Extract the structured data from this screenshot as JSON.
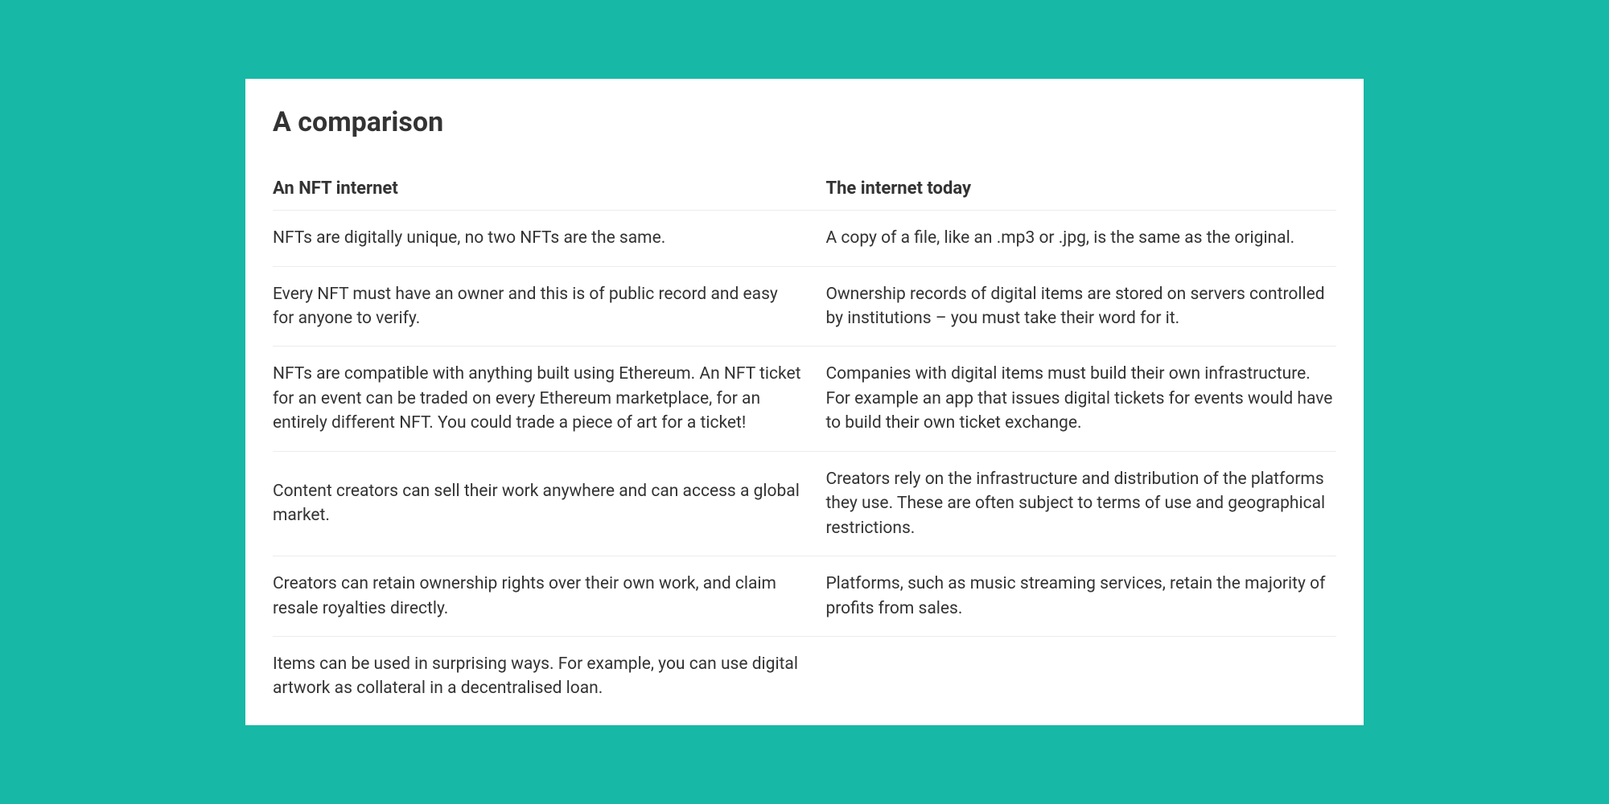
{
  "title": "A comparison",
  "table": {
    "headers": {
      "left": "An NFT internet",
      "right": "The internet today"
    },
    "rows": [
      {
        "left": "NFTs are digitally unique, no two NFTs are the same.",
        "right": "A copy of a file, like an .mp3 or .jpg, is the same as the original."
      },
      {
        "left": "Every NFT must have an owner and this is of public record and easy for anyone to verify.",
        "right": "Ownership records of digital items are stored on servers controlled by institutions – you must take their word for it."
      },
      {
        "left": "NFTs are compatible with anything built using Ethereum. An NFT ticket for an event can be traded on every Ethereum marketplace, for an entirely different NFT. You could trade a piece of art for a ticket!",
        "right": "Companies with digital items must build their own infrastructure. For example an app that issues digital tickets for events would have to build their own ticket exchange."
      },
      {
        "left": "Content creators can sell their work anywhere and can access a global market.",
        "right": "Creators rely on the infrastructure and distribution of the platforms they use. These are often subject to terms of use and geographical restrictions."
      },
      {
        "left": "Creators can retain ownership rights over their own work, and claim resale royalties directly.",
        "right": "Platforms, such as music streaming services, retain the majority of profits from sales."
      },
      {
        "left": "Items can be used in surprising ways. For example, you can use digital artwork as collateral in a decentralised loan.",
        "right": ""
      }
    ]
  }
}
